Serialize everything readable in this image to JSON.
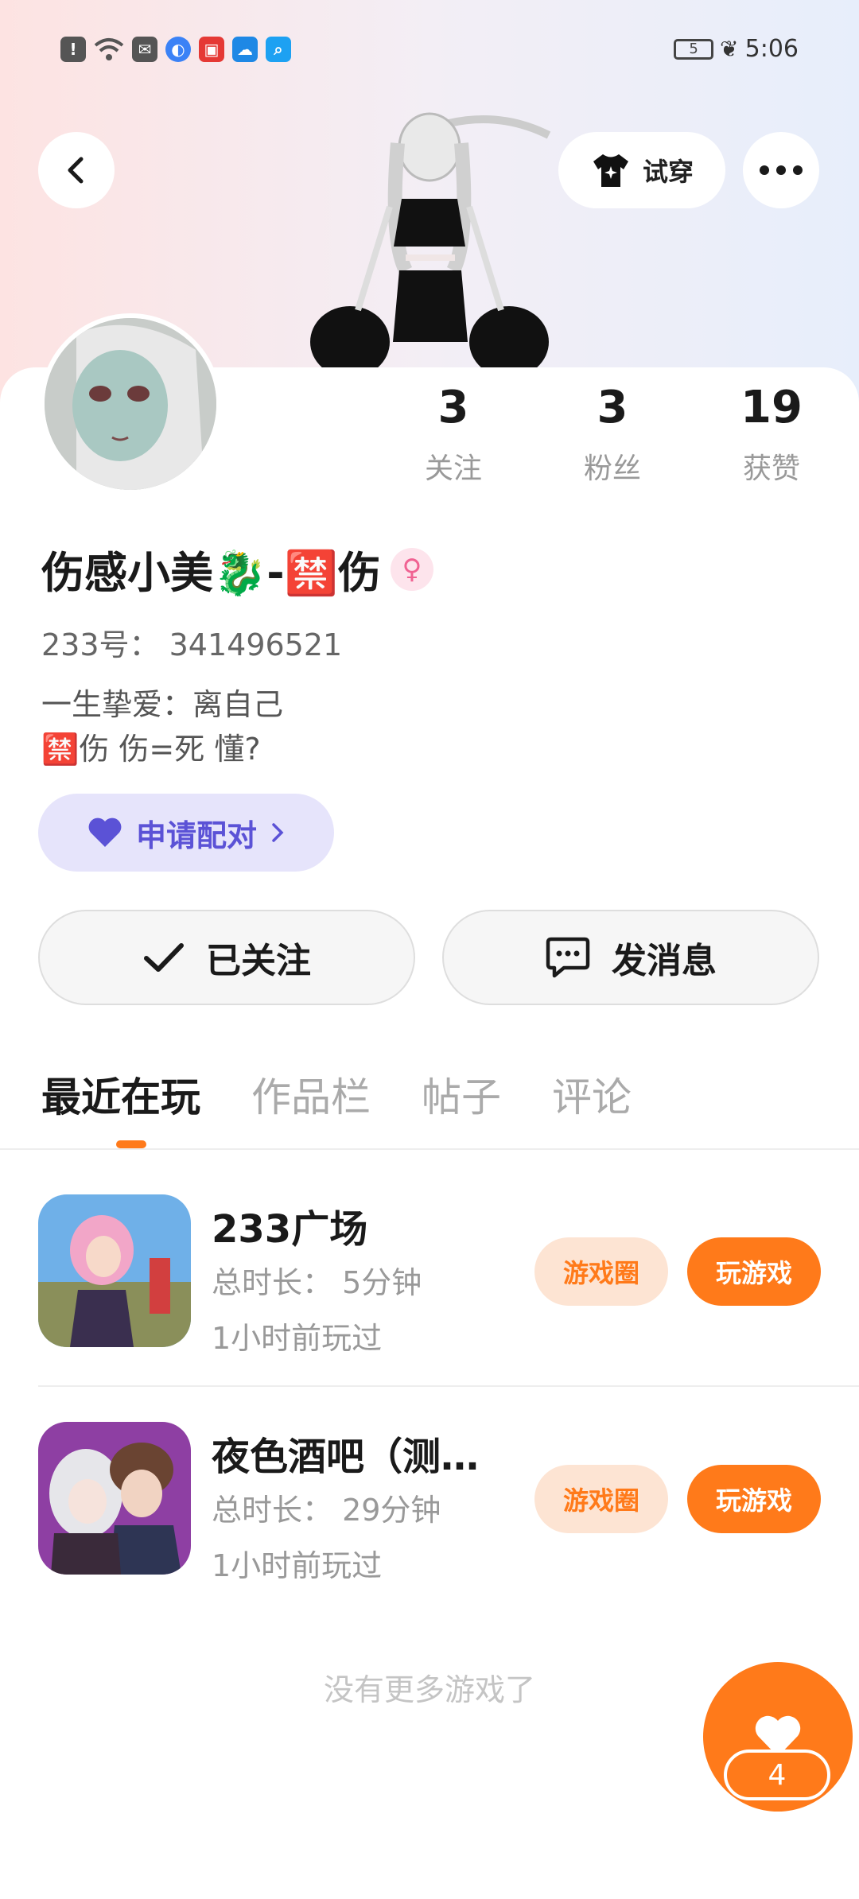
{
  "status_bar": {
    "time": "5:06",
    "battery_level": "5",
    "icons": [
      "alert-icon",
      "wifi-icon",
      "mail-icon",
      "browser-icon",
      "app-icon",
      "cloud-icon",
      "search-icon"
    ]
  },
  "header": {
    "try_on_label": "试穿"
  },
  "profile": {
    "stats": [
      {
        "value": "3",
        "label": "关注"
      },
      {
        "value": "3",
        "label": "粉丝"
      },
      {
        "value": "19",
        "label": "获赞"
      }
    ],
    "username": "伤感小美🐉-🈲伤",
    "gender_symbol": "♀",
    "user_id": "233号： 341496521",
    "bio_line1": "一生挚爱：离自己",
    "bio_line2": "🈲伤 伤=死 懂?",
    "pair_label": "申请配对",
    "followed_label": "已关注",
    "message_label": "发消息"
  },
  "tabs": [
    "最近在玩",
    "作品栏",
    "帖子",
    "评论"
  ],
  "games": [
    {
      "title": "233广场",
      "duration": "总时长： 5分钟",
      "last_played": "1小时前玩过",
      "circle_label": "游戏圈",
      "play_label": "玩游戏"
    },
    {
      "title": "夜色酒吧（测试版）",
      "duration": "总时长： 29分钟",
      "last_played": "1小时前玩过",
      "circle_label": "游戏圈",
      "play_label": "玩游戏"
    }
  ],
  "footer": {
    "no_more": "没有更多游戏了",
    "like_count": "4"
  },
  "colors": {
    "accent": "#ff7a1a",
    "pair_bg": "#e6e4fb",
    "pair_text": "#5b52d6"
  }
}
